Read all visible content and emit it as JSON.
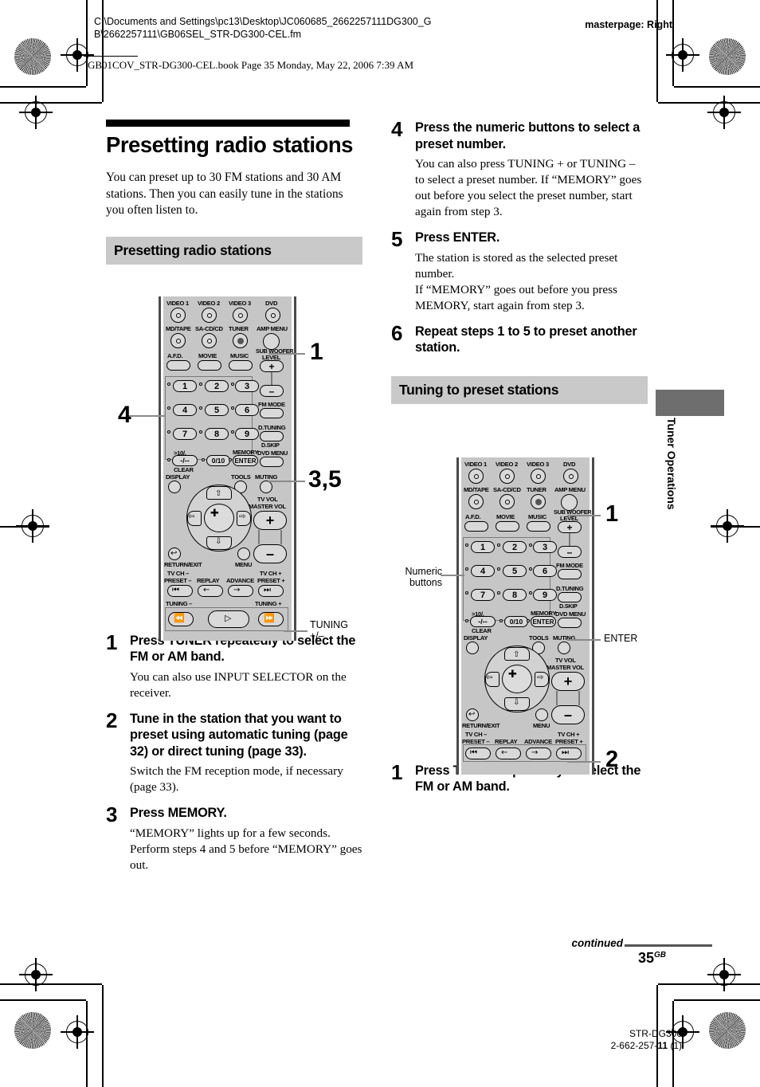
{
  "header": {
    "path": "C:\\Documents and Settings\\pc13\\Desktop\\JC060685_2662257111DG300_GB\\2662257111\\GB06SEL_STR-DG300-CEL.fm",
    "masterpage": "masterpage: Right",
    "bookline": "GB01COV_STR-DG300-CEL.book  Page 35  Monday, May 22, 2006  7:39 AM"
  },
  "main": {
    "title": "Presetting radio stations",
    "intro": "You can preset up to 30 FM stations and 30 AM stations. Then you can easily tune in the stations you often listen to.",
    "section1_heading": "Presetting radio stations",
    "section2_heading": "Tuning to preset stations"
  },
  "steps_left": [
    {
      "num": "1",
      "head": "Press TUNER repeatedly to select the FM or AM band.",
      "body": [
        "You can also use INPUT SELECTOR on the receiver."
      ]
    },
    {
      "num": "2",
      "head": "Tune in the station that you want to preset using automatic tuning (page 32) or direct tuning (page 33).",
      "body": [
        "Switch the FM reception mode, if necessary (page 33)."
      ]
    },
    {
      "num": "3",
      "head": "Press MEMORY.",
      "body": [
        "“MEMORY” lights up for a few seconds. Perform steps 4 and 5 before “MEMORY” goes out."
      ]
    }
  ],
  "steps_right": [
    {
      "num": "4",
      "head": "Press the numeric buttons to select a preset number.",
      "body": [
        "You can also press TUNING + or TUNING – to select a preset number. If “MEMORY” goes out before you select the preset number, start again from step 3."
      ]
    },
    {
      "num": "5",
      "head": "Press ENTER.",
      "body": [
        "The station is stored as the selected preset number.",
        "If “MEMORY” goes out before you press MEMORY, start again from step 3."
      ]
    },
    {
      "num": "6",
      "head": "Repeat steps 1 to 5 to preset another station.",
      "body": []
    }
  ],
  "steps_right2": [
    {
      "num": "1",
      "head": "Press TUNER repeatedly to select the FM or AM band.",
      "body": []
    }
  ],
  "remote1": {
    "row1": [
      "VIDEO 1",
      "VIDEO 2",
      "VIDEO 3",
      "DVD"
    ],
    "row2": [
      "MD/TAPE",
      "SA-CD/CD",
      "TUNER",
      "AMP MENU"
    ],
    "row3": [
      "A.F.D.",
      "MOVIE",
      "MUSIC"
    ],
    "subwoofer": "SUB WOOFER",
    "level": "LEVEL",
    "plus": "+",
    "minus": "–",
    "fm_mode": "FM MODE",
    "d_tuning": "D.TUNING",
    "d_skip": "D.SKIP",
    "dvd_menu": "DVD MENU",
    "numerics": [
      "1",
      "2",
      "3",
      "4",
      "5",
      "6",
      "7",
      "8",
      "9"
    ],
    "gt10": ">10/.",
    "dashdash": "-/--",
    "clear": "CLEAR",
    "zero": "0/10",
    "memory": "MEMORY",
    "enter": "ENTER",
    "display": "DISPLAY",
    "tools": "TOOLS",
    "muting": "MUTING",
    "tv_vol": "TV VOL",
    "master_vol": "MASTER VOL",
    "return_exit": "RETURN/EXIT",
    "menu": "MENU",
    "tv_ch_minus": "TV CH –",
    "preset_minus": "PRESET –",
    "replay": "REPLAY",
    "advance": "ADVANCE",
    "tv_ch_plus": "TV CH +",
    "preset_plus": "PRESET +",
    "tuning_minus": "TUNING –",
    "tuning_plus": "TUNING +"
  },
  "callouts1": {
    "one": "1",
    "four": "4",
    "three_five": "3,5",
    "tuning_line1": "TUNING",
    "tuning_line2": "+/–"
  },
  "callouts2": {
    "one": "1",
    "two": "2",
    "numeric_line1": "Numeric",
    "numeric_line2": "buttons",
    "enter": "ENTER"
  },
  "sidetab": {
    "label": "Tuner Operations",
    "band_color": "#6e6e6e"
  },
  "footer": {
    "continued": "continued",
    "pageno": "35",
    "pageno_sup": "GB",
    "model": "STR-DG300",
    "part_pre": "2-662-257-",
    "part_bold": "11",
    "part_post": " (1)"
  }
}
